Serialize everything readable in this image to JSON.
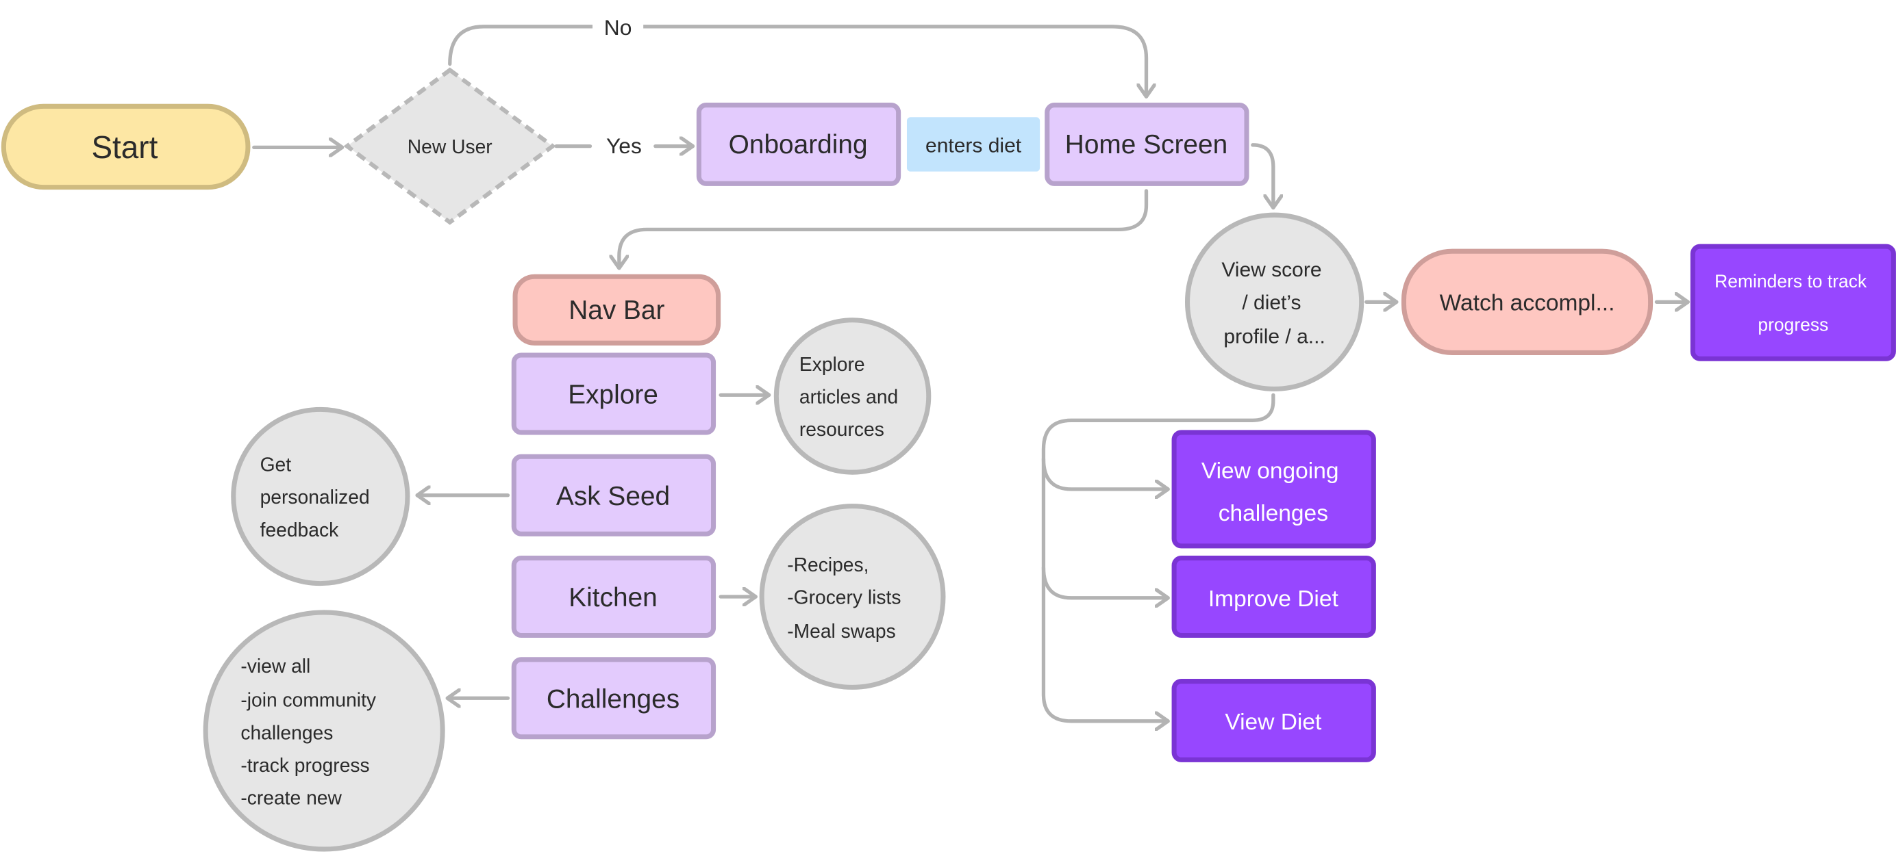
{
  "colors": {
    "start_fill": "#fde7a4",
    "start_stroke": "#cfbb80",
    "decision_fill": "#e6e6e6",
    "decision_stroke": "#b8b8b8",
    "screen_fill": "#e3cbfd",
    "screen_stroke": "#b7a2cc",
    "nav_fill": "#fec7c1",
    "nav_stroke": "#cf9e9a",
    "action_fill": "#9747ff",
    "action_stroke": "#7a34d4",
    "note_fill": "#c2e4fd",
    "connector": "#b3b3b3"
  },
  "nodes": {
    "start": "Start",
    "new_user": "New User",
    "onboarding": "Onboarding",
    "home_screen": "Home Screen",
    "nav_bar": "Nav Bar",
    "explore": "Explore",
    "ask_seed": "Ask Seed",
    "kitchen": "Kitchen",
    "challenges": "Challenges",
    "view_score": [
      "View score",
      "/ diet’s",
      "profile / a..."
    ],
    "watch": "Watch accompl...",
    "reminders": [
      "Reminders to track",
      "progress"
    ],
    "view_ongoing": [
      "View ongoing",
      "challenges"
    ],
    "improve_diet": "Improve Diet",
    "view_diet": "View Diet",
    "explore_detail": [
      "Explore",
      "articles and",
      "resources"
    ],
    "ask_seed_detail": [
      "Get",
      "personalized",
      "feedback"
    ],
    "kitchen_detail": [
      "-Recipes,",
      "-Grocery lists",
      "-Meal swaps"
    ],
    "challenges_detail": [
      "-view all",
      "-join community",
      "challenges",
      "-track progress",
      "-create new"
    ]
  },
  "edge_labels": {
    "no": "No",
    "yes": "Yes",
    "enters_diet": "enters diet"
  }
}
